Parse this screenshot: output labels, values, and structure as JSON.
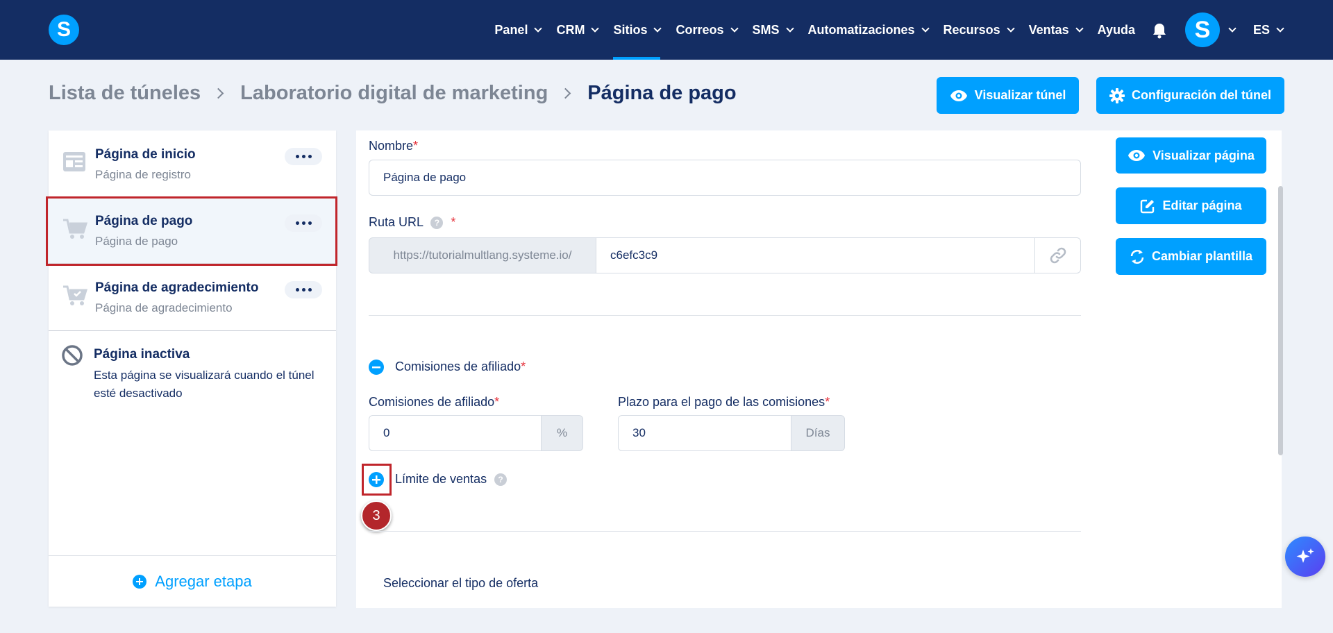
{
  "nav": {
    "logo": "S",
    "items": [
      {
        "label": "Panel",
        "has_dropdown": true
      },
      {
        "label": "CRM",
        "has_dropdown": true
      },
      {
        "label": "Sitios",
        "has_dropdown": true,
        "active": true
      },
      {
        "label": "Correos",
        "has_dropdown": true
      },
      {
        "label": "SMS",
        "has_dropdown": true
      },
      {
        "label": "Automatizaciones",
        "has_dropdown": true
      },
      {
        "label": "Recursos",
        "has_dropdown": true
      },
      {
        "label": "Ventas",
        "has_dropdown": true
      },
      {
        "label": "Ayuda",
        "has_dropdown": false
      }
    ],
    "avatar_letter": "S",
    "language": "ES"
  },
  "breadcrumb": {
    "items": [
      "Lista de túneles",
      "Laboratorio digital de marketing"
    ],
    "current": "Página de pago"
  },
  "header_buttons": {
    "preview_funnel": "Visualizar túnel",
    "funnel_settings": "Configuración del túnel"
  },
  "steps": [
    {
      "title": "Página de inicio",
      "subtitle": "Página de registro",
      "icon": "landing-page-icon"
    },
    {
      "title": "Página de pago",
      "subtitle": "Página de pago",
      "icon": "cart-icon",
      "selected": true
    },
    {
      "title": "Página de agradecimiento",
      "subtitle": "Página de agradecimiento",
      "icon": "cart-check-icon"
    }
  ],
  "inactive": {
    "title": "Página inactiva",
    "description": "Esta página se visualizará cuando el túnel esté desactivado"
  },
  "add_step": "Agregar etapa",
  "form": {
    "name_label": "Nombre",
    "name_value": "Página de pago",
    "url_label": "Ruta URL",
    "url_prefix": "https://tutorialmultlang.systeme.io/",
    "url_value": "c6efc3c9",
    "commissions_toggle": "Comisiones de afiliado",
    "commissions_label": "Comisiones de afiliado",
    "commissions_value": "0",
    "commissions_unit": "%",
    "payment_delay_label": "Plazo para el pago de las comisiones",
    "payment_delay_value": "30",
    "payment_delay_unit": "Días",
    "sales_limit": "Límite de ventas",
    "offer_type": "Seleccionar el tipo de oferta",
    "required_mark": "*",
    "help_mark": "?"
  },
  "side_buttons": {
    "preview_page": "Visualizar página",
    "edit_page": "Editar página",
    "change_template": "Cambiar plantilla"
  },
  "step_marker": "3",
  "colors": {
    "nav_bg": "#142d63",
    "accent": "#00a0ff",
    "highlight": "#c0252b"
  }
}
